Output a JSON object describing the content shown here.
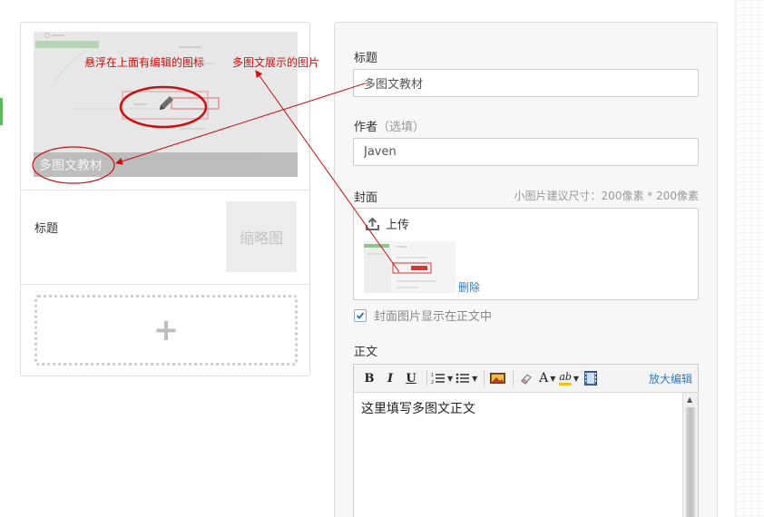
{
  "preview": {
    "cover_title": "多图文教材",
    "item_title": "标题",
    "thumbnail_label": "缩略图",
    "add_symbol": "+"
  },
  "form": {
    "title_label": "标题",
    "title_value": "多图文教材",
    "author_label": "作者",
    "author_hint": "（选填）",
    "author_value": "Javen",
    "cover_label": "封面",
    "cover_hint": "小图片建议尺寸：200像素 * 200像素",
    "upload_label": "上传",
    "delete_label": "删除",
    "show_cover_label": "封面图片显示在正文中",
    "show_cover_checked": true,
    "body_label": "正文"
  },
  "editor": {
    "toolbar": {
      "bold": "B",
      "italic": "I",
      "underline": "U",
      "font_color": "A",
      "highlight": "ab",
      "fullscreen_label": "放大编辑"
    },
    "content": "这里填写多图文正文"
  },
  "annotations": {
    "hover_edit_note": "悬浮在上面有编辑的图标",
    "cover_display_note": "多图文展示的图片"
  },
  "colors": {
    "annotation": "#cc1010",
    "link": "#2f7bc1",
    "accent_green": "#5cb85c",
    "panel_border": "#dddddd"
  },
  "icons": {
    "edit": "pencil-icon",
    "upload": "upload-icon",
    "checkbox": "check-icon",
    "add": "plus-icon"
  }
}
